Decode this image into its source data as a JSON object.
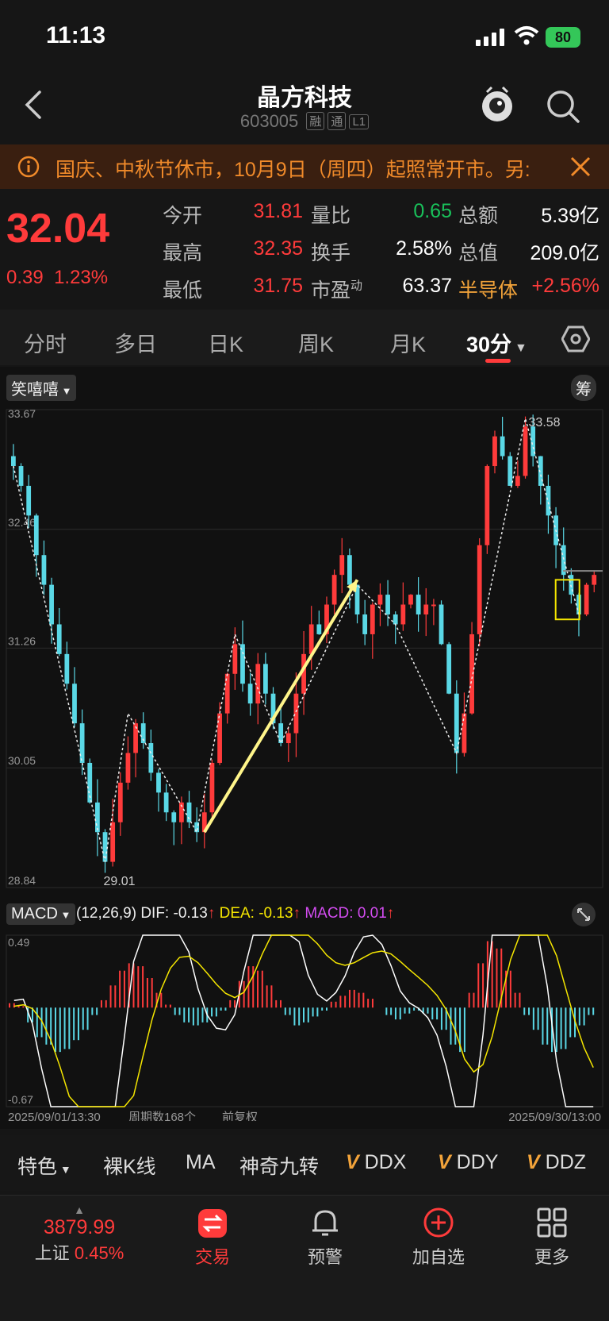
{
  "status": {
    "time": "11:13",
    "battery": "80"
  },
  "header": {
    "title": "晶方科技",
    "code": "603005",
    "tags": [
      "融",
      "通",
      "L1"
    ]
  },
  "notice": {
    "text": "国庆、中秋节休市，10月9日（周四）起照常开市。另:"
  },
  "quote": {
    "price": "32.04",
    "change": "0.39",
    "change_pct": "1.23%",
    "rows": [
      {
        "l1": "今开",
        "v1": "31.81",
        "l2": "量比",
        "v2": "0.65",
        "l3": "总额",
        "v3": "5.39亿"
      },
      {
        "l1": "最高",
        "v1": "32.35",
        "l2": "换手",
        "v2": "2.58%",
        "l3": "总值",
        "v3": "209.0亿"
      },
      {
        "l1": "最低",
        "v1": "31.75",
        "l2": "市盈",
        "v2": "63.37",
        "l3": "半导体",
        "v3": "+2.56%"
      }
    ],
    "pe_sup": "动"
  },
  "tabs": [
    "分时",
    "多日",
    "日K",
    "周K",
    "月K",
    "30分"
  ],
  "chart": {
    "strategy_label": "笑嘻嘻",
    "chip_label": "筹",
    "high_label": "33.58",
    "low_label": "29.01",
    "y_labels": [
      "33.67",
      "32.46",
      "31.26",
      "30.05",
      "28.84"
    ],
    "macd_label": "MACD",
    "macd_params": "(12,26,9)",
    "dif": "DIF: -0.13",
    "dea": "DEA: -0.13",
    "macd": "MACD: 0.01",
    "macd_top": "0.49",
    "macd_bottom": "-0.67",
    "date_start": "2025/09/01/13:30",
    "period_count": "周期数168个",
    "adjust": "前复权",
    "date_end": "2025/09/30/13:00",
    "colors": {
      "up": "#ff3b3b",
      "down": "#5ad8e6",
      "dif": "#ffffff",
      "dea": "#f5e600",
      "arrow": "#fff58a"
    }
  },
  "chart_data": {
    "type": "candlestick",
    "title": "",
    "xlabel": "",
    "ylabel": "",
    "ylim": [
      28.84,
      33.67
    ],
    "x_range": [
      "2025/09/01/13:30",
      "2025/09/30/13:00"
    ],
    "periods": 168,
    "close_series": [
      33.1,
      32.9,
      32.6,
      32.2,
      31.9,
      31.5,
      31.2,
      30.9,
      30.5,
      30.1,
      29.7,
      29.4,
      29.1,
      29.5,
      29.9,
      30.2,
      30.5,
      30.3,
      30.0,
      29.8,
      29.6,
      29.5,
      29.7,
      29.5,
      29.4,
      29.6,
      30.1,
      30.6,
      31.0,
      31.3,
      30.9,
      30.7,
      31.1,
      30.8,
      30.5,
      30.3,
      30.4,
      30.8,
      31.2,
      31.5,
      31.4,
      31.7,
      32.0,
      32.2,
      31.9,
      31.6,
      31.4,
      31.7,
      31.8,
      31.6,
      31.5,
      31.7,
      31.8,
      31.6,
      31.7,
      31.7,
      31.3,
      30.8,
      30.2,
      30.6,
      31.4,
      32.3,
      33.1,
      33.4,
      33.2,
      32.9,
      33.0,
      33.5,
      33.2,
      32.9,
      32.6,
      32.3,
      32.0,
      31.8,
      31.6,
      31.9,
      32.0
    ],
    "annotations": {
      "high": 33.58,
      "low": 29.01
    },
    "macd": {
      "dif": -0.13,
      "dea": -0.13,
      "macd": 0.01,
      "ylim": [
        -0.67,
        0.49
      ],
      "hist": [
        0.03,
        0.01,
        -0.1,
        -0.2,
        -0.25,
        -0.3,
        -0.28,
        -0.22,
        -0.15,
        -0.05,
        0.05,
        0.15,
        0.25,
        0.3,
        0.28,
        0.2,
        0.1,
        0.02,
        -0.05,
        -0.1,
        -0.12,
        -0.1,
        -0.06,
        -0.02,
        0.05,
        0.18,
        0.28,
        0.25,
        0.15,
        0.05,
        -0.05,
        -0.12,
        -0.1,
        -0.06,
        -0.02,
        0.04,
        0.08,
        0.12,
        0.1,
        0.06,
        0.0,
        -0.05,
        -0.08,
        -0.04,
        -0.02,
        -0.04,
        -0.08,
        -0.15,
        -0.25,
        -0.3,
        0.1,
        0.3,
        0.45,
        0.4,
        0.25,
        0.1,
        -0.05,
        -0.15,
        -0.25,
        -0.3,
        -0.28,
        -0.2,
        -0.12,
        -0.05
      ]
    }
  },
  "indicators": {
    "feature": "特色",
    "items": [
      "裸K线",
      "MA",
      "神奇九转"
    ],
    "v_items": [
      "DDX",
      "DDY",
      "DDZ"
    ]
  },
  "nav": {
    "index_value": "3879.99",
    "index_name": "上证",
    "index_pct": "0.45%",
    "items": [
      "交易",
      "预警",
      "加自选",
      "更多"
    ]
  }
}
